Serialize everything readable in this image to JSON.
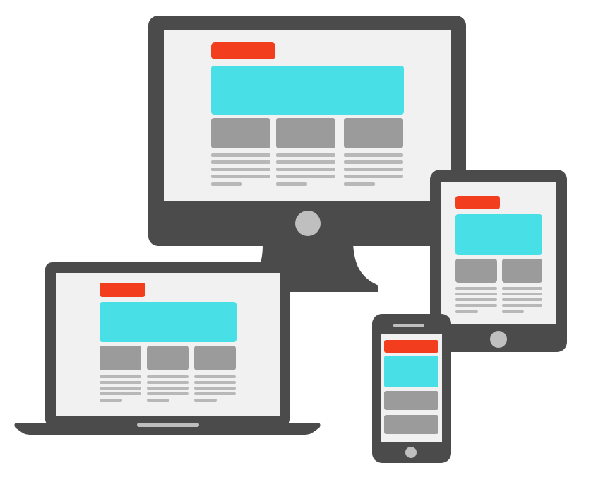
{
  "colors": {
    "device_frame": "#4b4b4b",
    "screen_bg": "#f1f1f1",
    "header_bar": "#f23d1f",
    "hero_block": "#48dfe6",
    "card_block": "#9b9b9b",
    "text_line": "#b8b8b8",
    "button": "#bfbfbf",
    "background": "#ffffff"
  },
  "devices": [
    {
      "name": "desktop-monitor",
      "icon": "desktop-icon"
    },
    {
      "name": "laptop",
      "icon": "laptop-icon"
    },
    {
      "name": "tablet",
      "icon": "tablet-icon"
    },
    {
      "name": "smartphone",
      "icon": "smartphone-icon"
    }
  ]
}
